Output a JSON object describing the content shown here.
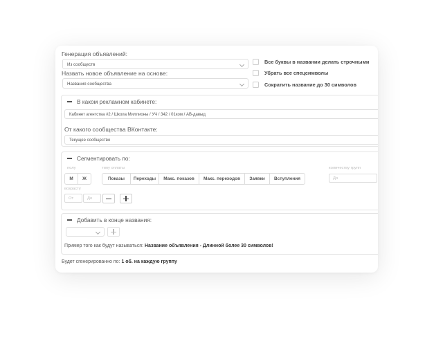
{
  "generation": {
    "label": "Генерация объявлений:",
    "value": "Из сообществ"
  },
  "name_based_on": {
    "label": "Назвать новое объявление на основе:",
    "value": "Названия сообщества"
  },
  "options": {
    "lowercase": "Все буквы в названии делать строчными",
    "remove_special": "Убрать все спецсимволы",
    "shorten": "Сократить название до 30 символов"
  },
  "ad_cabinet": {
    "title": "В каком рекламном кабинете:",
    "value": "Кабинет агентства #2 / Школа Миллионы / УЧ / 342 / 01ком / АВ-давыд",
    "community_label": "От какого сообщества ВКонтакте:",
    "community_value": "Текущее сообщество"
  },
  "segment": {
    "title": "Сегментировать по:",
    "gender_label": "полу",
    "gender_buttons": [
      "М",
      "Ж"
    ],
    "payment_label": "типу оплаты",
    "payment_buttons": [
      "Показы",
      "Переходы",
      "Макс. показов",
      "Макс. переходов",
      "Заявки",
      "Вступления"
    ],
    "groups_label": "количеству групп",
    "groups_placeholder": "До",
    "age_label": "возрасту",
    "age_from": "От",
    "age_to": "До"
  },
  "append": {
    "title": "Добавить в конце названия:",
    "example_prefix": "Пример того как будут называться:",
    "example_value": "Название объявления - Длинной более 30 символов!"
  },
  "footer": {
    "prefix": "Будет сгенерированно по:",
    "value": "1 об. на каждую группу"
  }
}
